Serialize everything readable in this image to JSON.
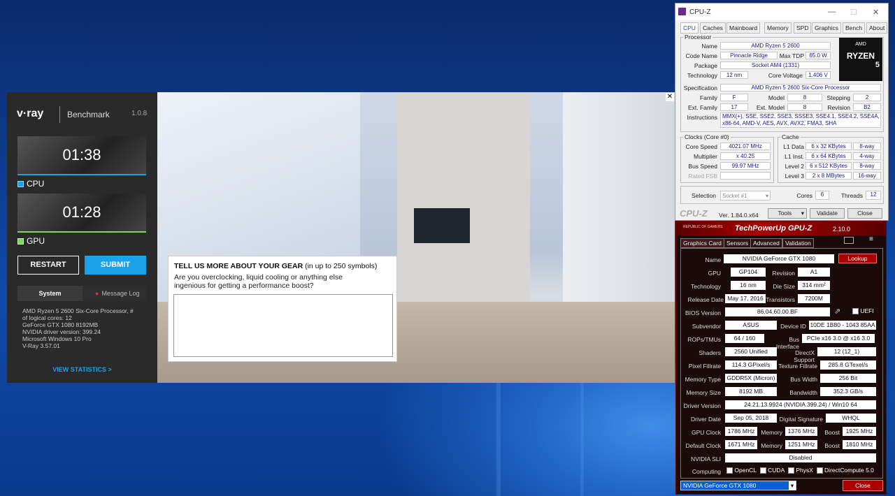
{
  "vray": {
    "logo": "v·ray",
    "app": "Benchmark",
    "version": "1.0.8",
    "cpu_time": "01:38",
    "cpu_label": "CPU",
    "gpu_time": "01:28",
    "gpu_label": "GPU",
    "restart": "RESTART",
    "submit": "SUBMIT",
    "tab_system": "System",
    "tab_log": "Message Log",
    "sysinfo": [
      "AMD Ryzen 5 2600 Six-Core Processor, #",
      "of logical cores: 12",
      "GeForce GTX 1080 8192MB",
      "NVIDIA driver version: 399.24",
      "Microsoft Windows 10 Pro",
      "V-Ray 3.57.01"
    ],
    "view_stats": "VIEW STATISTICS >",
    "colors": {
      "accent": "#1aa3e8",
      "cpu_bar": "#1aa3e8",
      "gpu_bar": "#7ed957"
    }
  },
  "gear": {
    "title": "TELL US MORE ABOUT YOUR GEAR",
    "title_suffix": " (in up to 250 symbols)",
    "question": "Are you overclocking, liquid cooling or anything else ingenious for getting a performance boost?"
  },
  "cpuz": {
    "title": "CPU-Z",
    "tabs": [
      "CPU",
      "Caches",
      "Mainboard",
      "Memory",
      "SPD",
      "Graphics",
      "Bench",
      "About"
    ],
    "processor": "Processor",
    "name_k": "Name",
    "name": "AMD Ryzen 5 2600",
    "codename_k": "Code Name",
    "codename": "Pinnacle Ridge",
    "tdp_k": "Max TDP",
    "tdp": "65.0 W",
    "package_k": "Package",
    "package": "Socket AM4 (1331)",
    "tech_k": "Technology",
    "tech": "12 nm",
    "cv_k": "Core Voltage",
    "cv": "1.406 V",
    "spec_k": "Specification",
    "spec": "AMD Ryzen 5 2600 Six-Core Processor",
    "family_k": "Family",
    "family": "F",
    "model_k": "Model",
    "model": "8",
    "stepping_k": "Stepping",
    "stepping": "2",
    "extfam_k": "Ext. Family",
    "extfam": "17",
    "extmodel_k": "Ext. Model",
    "extmodel": "8",
    "rev_k": "Revision",
    "rev": "B2",
    "instr_k": "Instructions",
    "instr1": "MMX(+), SSE, SSE2, SSE3, SSSE3, SSE4.1, SSE4.2, SSE4A,",
    "instr2": "x86-64, AMD-V, AES, AVX, AVX2, FMA3, SHA",
    "clocks": "Clocks (Core #0)",
    "cache": "Cache",
    "cs_k": "Core Speed",
    "cs": "4021.07 MHz",
    "mult_k": "Multiplier",
    "mult": "x 40.25",
    "bus_k": "Bus Speed",
    "bus": "99.97 MHz",
    "fsb_k": "Rated FSB",
    "l1d_k": "L1 Data",
    "l1d": "6 x 32 KBytes",
    "l1d_w": "8-way",
    "l1i_k": "L1 Inst.",
    "l1i": "6 x 64 KBytes",
    "l1i_w": "4-way",
    "l2_k": "Level 2",
    "l2": "6 x 512 KBytes",
    "l2_w": "8-way",
    "l3_k": "Level 3",
    "l3": "2 x 8 MBytes",
    "l3_w": "16-way",
    "sel_k": "Selection",
    "sel": "Socket #1",
    "cores_k": "Cores",
    "cores": "6",
    "threads_k": "Threads",
    "threads": "12",
    "brand": "CPU-Z",
    "ver": "Ver. 1.84.0.x64",
    "tools": "Tools",
    "validate": "Validate",
    "close": "Close",
    "badge_amd": "AMD",
    "badge_ryzen": "RYZEN",
    "badge_num": "5"
  },
  "gpuz": {
    "title": "TechPowerUp GPU-Z",
    "ver": "2.10.0",
    "rog": "REPUBLIC OF GAMERS",
    "tabs": [
      "Graphics Card",
      "Sensors",
      "Advanced",
      "Validation"
    ],
    "lookup": "Lookup",
    "rows": [
      {
        "k": "Name",
        "v": "NVIDIA GeForce GTX 1080"
      },
      {
        "k": "GPU",
        "v": "GP104",
        "k2": "Revision",
        "v2": "A1"
      },
      {
        "k": "Technology",
        "v": "16 nm",
        "k2": "Die Size",
        "v2": "314 mm²"
      },
      {
        "k": "Release Date",
        "v": "May 17, 2016",
        "k2": "Transistors",
        "v2": "7200M"
      },
      {
        "k": "BIOS Version",
        "v": "86.04.60.00.BF",
        "k2": "UEFI"
      },
      {
        "k": "Subvendor",
        "v": "ASUS",
        "k2": "Device ID",
        "v2": "10DE 1B80 - 1043 85AA"
      },
      {
        "k": "ROPs/TMUs",
        "v": "64 / 160",
        "k2": "Bus Interface",
        "v2": "PCIe x16 3.0 @ x16 3.0"
      },
      {
        "k": "Shaders",
        "v": "2560 Unified",
        "k2": "DirectX Support",
        "v2": "12 (12_1)"
      },
      {
        "k": "Pixel Fillrate",
        "v": "114.3 GPixel/s",
        "k2": "Texture Fillrate",
        "v2": "285.8 GTexel/s"
      },
      {
        "k": "Memory Type",
        "v": "GDDR5X (Micron)",
        "k2": "Bus Width",
        "v2": "256 Bit"
      },
      {
        "k": "Memory Size",
        "v": "8192 MB",
        "k2": "Bandwidth",
        "v2": "352.3 GB/s"
      },
      {
        "k": "Driver Version",
        "v": "24.21.13.9924 (NVIDIA 399.24) / Win10 64"
      },
      {
        "k": "Driver Date",
        "v": "Sep 05, 2018",
        "k2": "Digital Signature",
        "v2": "WHQL"
      }
    ],
    "clk_k": "GPU Clock",
    "clk": "1786 MHz",
    "mem_k": "Memory",
    "mem": "1376 MHz",
    "boost_k": "Boost",
    "boost": "1925 MHz",
    "dclk_k": "Default Clock",
    "dclk": "1671 MHz",
    "dmem": "1251 MHz",
    "dboost": "1810 MHz",
    "sli_k": "NVIDIA SLI",
    "sli": "Disabled",
    "comp_k": "Computing",
    "opencl": "OpenCL",
    "cuda": "CUDA",
    "physx": "PhysX",
    "dc": "DirectCompute 5.0",
    "select": "NVIDIA GeForce GTX 1080",
    "close": "Close"
  }
}
